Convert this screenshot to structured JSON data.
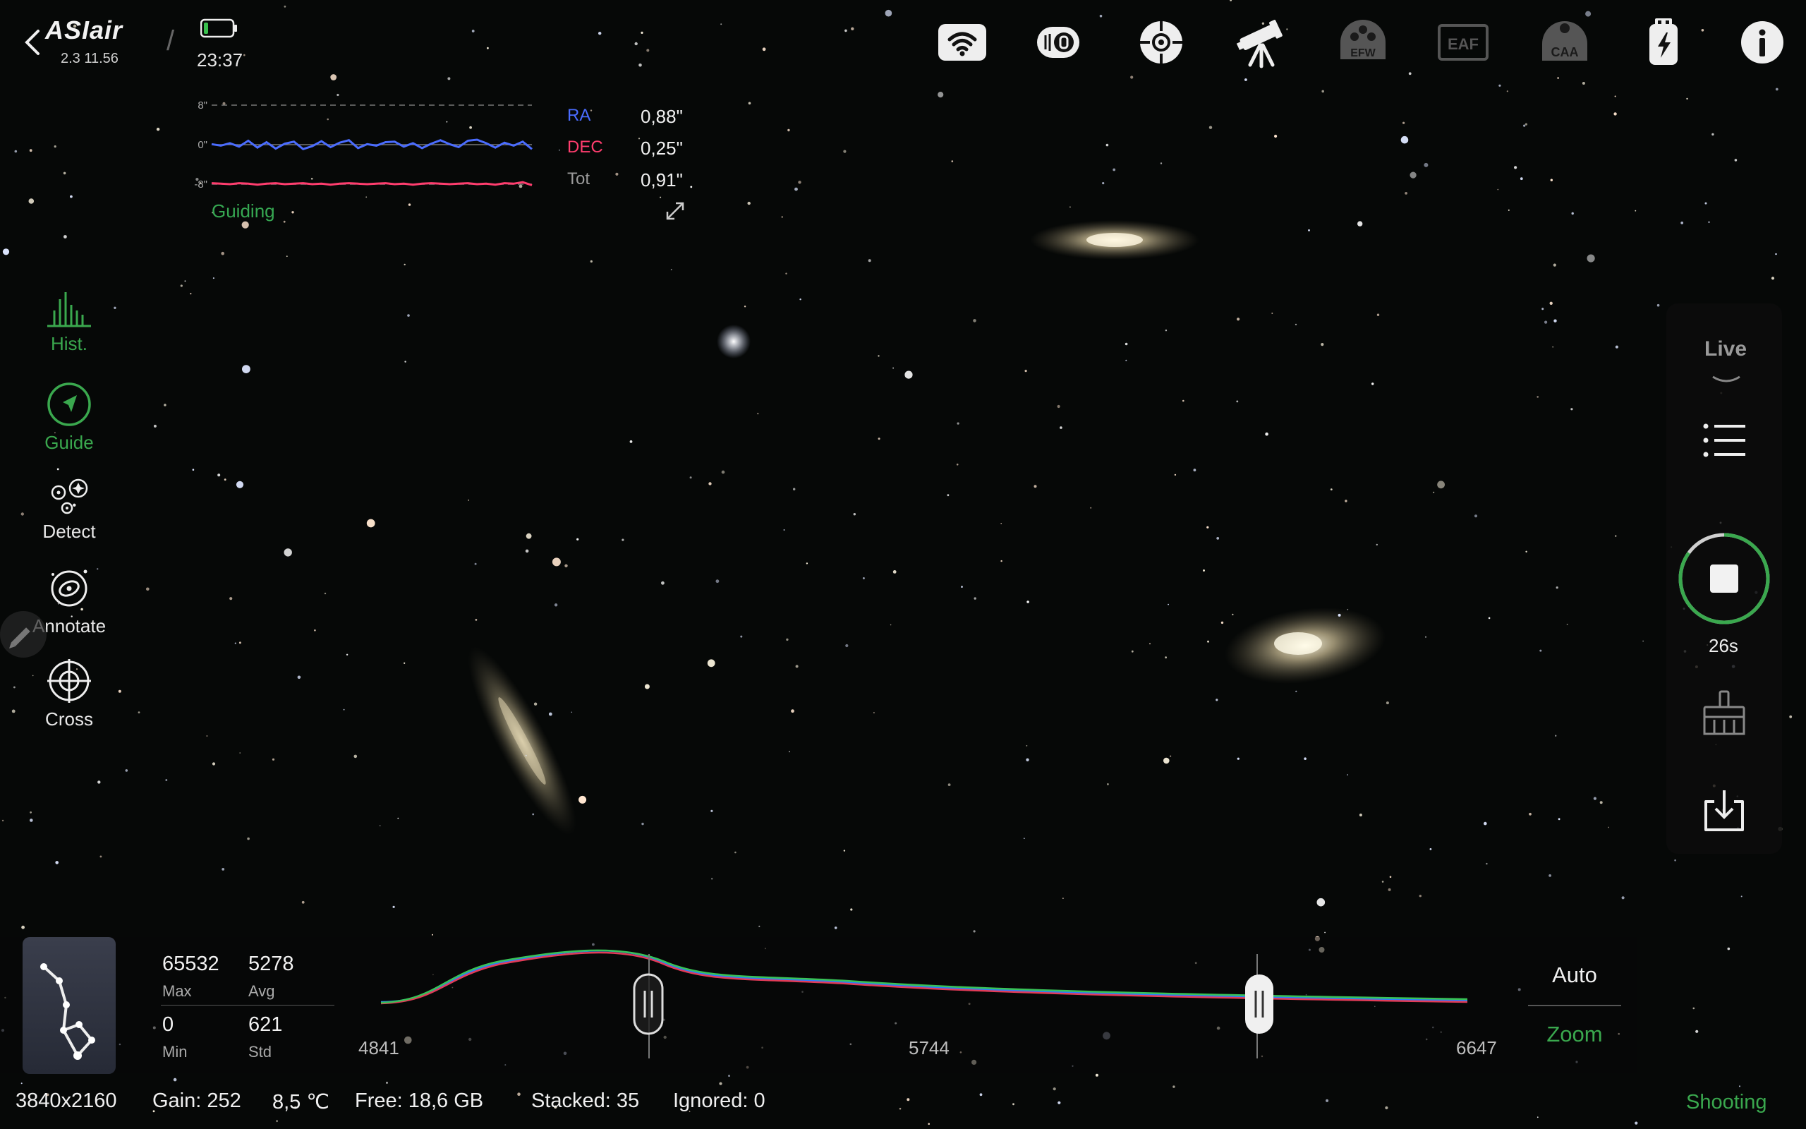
{
  "header": {
    "brand": "ASIair",
    "version": "2.3 11.56",
    "time": "23:37",
    "icons": [
      "back-icon",
      "battery-icon",
      "wifi-icon",
      "camera-icon",
      "guide-scope-icon",
      "telescope-icon",
      "efw-icon",
      "eaf-icon",
      "caa-icon",
      "usb-power-icon",
      "info-icon"
    ],
    "efw_text": "EFW",
    "eaf_text": "EAF",
    "caa_text": "CAA"
  },
  "guiding": {
    "y_ticks": [
      "8\"",
      "0\"",
      "-8\""
    ],
    "ra_label": "RA",
    "ra_value": "0,88\"",
    "dec_label": "DEC",
    "dec_value": "0,25\"",
    "tot_label": "Tot",
    "tot_value": "0,91\"",
    "status": "Guiding",
    "ra_color": "#4a6cff",
    "dec_color": "#ff3d6e",
    "ra_series": [
      0.1,
      -0.2,
      0.3,
      -0.4,
      0.8,
      -0.6,
      0.5,
      -0.8,
      0.2,
      0.6,
      -0.9,
      -0.3,
      0.7,
      -0.5,
      0.4,
      0.9,
      -0.7,
      0.1,
      -0.2,
      0.5,
      0.6,
      -0.4,
      0.3,
      -0.7,
      0.2,
      0.9,
      0.1,
      -0.5,
      0.8,
      1.0,
      0.3,
      -0.6,
      0.4,
      -0.2,
      0.6,
      -0.9
    ],
    "dec_series": [
      -7.8,
      -7.9,
      -8.0,
      -7.8,
      -7.9,
      -8.1,
      -7.9,
      -7.8,
      -8.0,
      -7.9,
      -7.8,
      -8.0,
      -7.9,
      -8.1,
      -7.9,
      -7.8,
      -7.9,
      -8.0,
      -7.9,
      -7.8,
      -8.0,
      -7.9,
      -8.1,
      -7.9,
      -7.8,
      -7.9,
      -8.0,
      -7.9,
      -7.8,
      -8.0,
      -7.9,
      -8.1,
      -7.8,
      -7.9,
      -7.6,
      -8.2
    ]
  },
  "tools": {
    "hist": "Hist.",
    "guide": "Guide",
    "detect": "Detect",
    "annotate": "Annotate",
    "cross": "Cross"
  },
  "capture": {
    "mode": "Live",
    "countdown": "26s",
    "progress": 0.85
  },
  "histogram": {
    "max_value": "65532",
    "max_label": "Max",
    "avg_value": "5278",
    "avg_label": "Avg",
    "min_value": "0",
    "min_label": "Min",
    "std_value": "621",
    "std_label": "Std",
    "axis_left": "4841",
    "axis_mid": "5744",
    "axis_right": "6647",
    "auto_label": "Auto",
    "zoom_label": "Zoom"
  },
  "status_bar": {
    "resolution": "3840x2160",
    "gain": "Gain: 252",
    "temperature": "8,5 ℃",
    "free": "Free: 18,6 GB",
    "stacked": "Stacked: 35",
    "ignored": "Ignored: 0",
    "state": "Shooting"
  },
  "colors": {
    "accent_green": "#3aa84e"
  }
}
